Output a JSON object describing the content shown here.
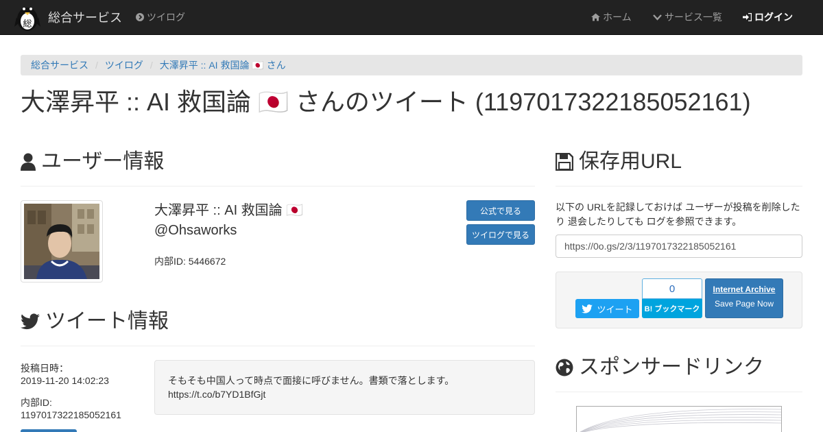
{
  "navbar": {
    "brand_text": "総合サービス",
    "twilog_label": "ツイログ",
    "home_label": "ホーム",
    "services_label": "サービス一覧",
    "login_label": "ログイン"
  },
  "breadcrumb": [
    "総合サービス",
    "ツイログ",
    "大澤昇平 :: AI 救国論 🇯🇵 さん"
  ],
  "page_title": "大澤昇平 :: AI 救国論 🇯🇵 さんのツイート (1197017322185052161)",
  "user_section": {
    "heading": "ユーザー情報",
    "display_name": "大澤昇平 :: AI 救国論 🇯🇵",
    "handle": "@Ohsaworks",
    "internal_id": "内部ID: 5446672",
    "official_button": "公式で見る",
    "twilog_button": "ツイログで見る"
  },
  "tweet_section": {
    "heading": "ツイート情報",
    "posted_label": "投稿日時：",
    "posted_value": "2019-11-20 14:02:23",
    "internal_label": "内部ID:",
    "internal_value": "1197017322185052161",
    "text_line1": "そもそも中国人って時点で面接に呼びません。書類で落とします。",
    "text_line2": "https://t.co/b7YD1BfGjt"
  },
  "save_section": {
    "heading": "保存用URL",
    "description": "以下の URLを記録しておけば ユーザーが投稿を削除したり 退会したりしても ログを参照できます。",
    "url": "https://0o.gs/2/3/1197017322185052161",
    "tweet_button": "ツイート",
    "hatena_count": "0",
    "hatena_label": "B! ブックマーク",
    "archive_title": "Internet Archive",
    "archive_sub": "Save Page Now"
  },
  "sponsor_section": {
    "heading": "スポンサードリンク"
  },
  "colors": {
    "navbar_bg": "#222222",
    "link_blue": "#337ab7",
    "twitter_blue": "#1da1f2",
    "hatena_blue": "#00a4de"
  }
}
